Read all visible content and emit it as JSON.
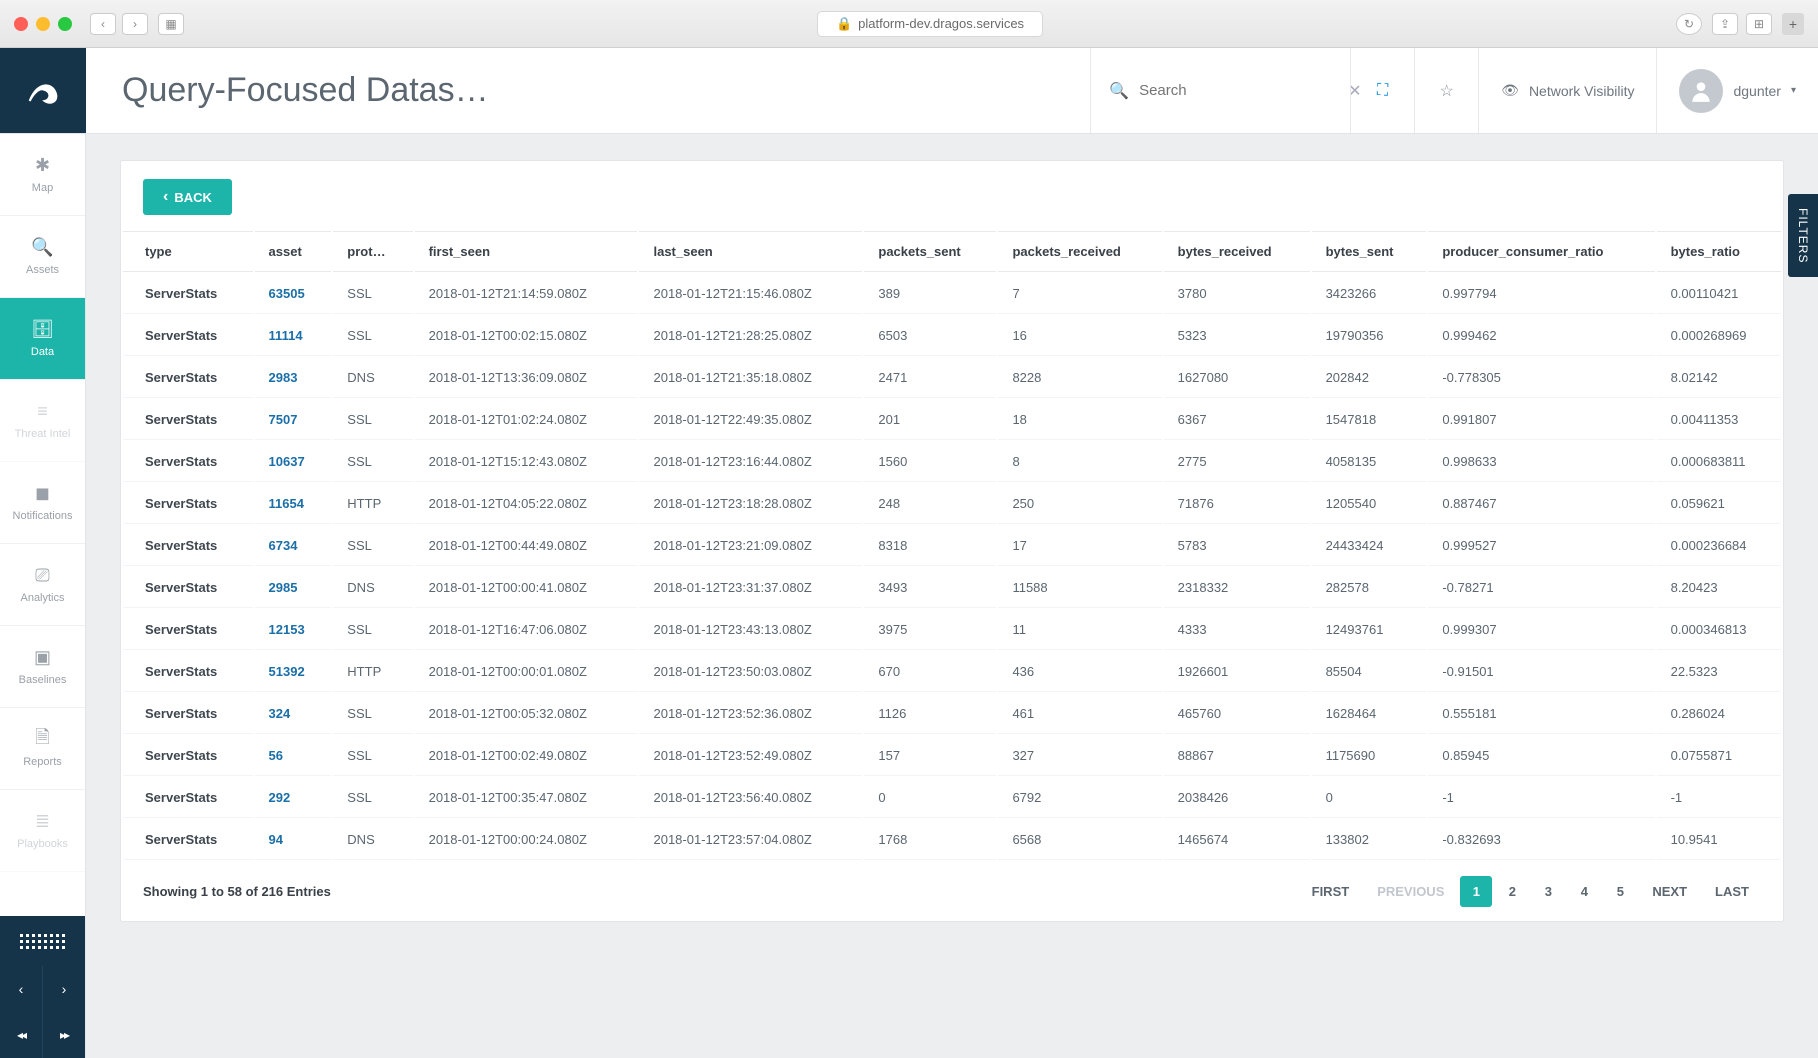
{
  "browser": {
    "url": "platform-dev.dragos.services"
  },
  "header": {
    "title": "Query-Focused Datas…",
    "search_placeholder": "Search",
    "visibility_label": "Network Visibility",
    "username": "dgunter"
  },
  "sidebar": {
    "items": [
      {
        "label": "Map",
        "active": false,
        "disabled": false,
        "icon": "map"
      },
      {
        "label": "Assets",
        "active": false,
        "disabled": false,
        "icon": "search"
      },
      {
        "label": "Data",
        "active": true,
        "disabled": false,
        "icon": "database"
      },
      {
        "label": "Threat Intel",
        "active": false,
        "disabled": true,
        "icon": "bars"
      },
      {
        "label": "Notifications",
        "active": false,
        "disabled": false,
        "icon": "bell"
      },
      {
        "label": "Analytics",
        "active": false,
        "disabled": false,
        "icon": "sliders"
      },
      {
        "label": "Baselines",
        "active": false,
        "disabled": false,
        "icon": "layers"
      },
      {
        "label": "Reports",
        "active": false,
        "disabled": false,
        "icon": "file"
      },
      {
        "label": "Playbooks",
        "active": false,
        "disabled": true,
        "icon": "stack"
      }
    ]
  },
  "back_label": "BACK",
  "filters_label": "FILTERS",
  "table": {
    "headers": [
      "type",
      "asset",
      "prot…",
      "first_seen",
      "last_seen",
      "packets_sent",
      "packets_received",
      "bytes_received",
      "bytes_sent",
      "producer_consumer_ratio",
      "bytes_ratio"
    ],
    "rows": [
      {
        "type": "ServerStats",
        "asset": "63505",
        "proto": "SSL",
        "first_seen": "2018-01-12T21:14:59.080Z",
        "last_seen": "2018-01-12T21:15:46.080Z",
        "pkts_sent": "389",
        "pkts_recv": "7",
        "bytes_recv": "3780",
        "bytes_sent": "3423266",
        "pcr": "0.997794",
        "bytes_ratio": "0.00110421"
      },
      {
        "type": "ServerStats",
        "asset": "11114",
        "proto": "SSL",
        "first_seen": "2018-01-12T00:02:15.080Z",
        "last_seen": "2018-01-12T21:28:25.080Z",
        "pkts_sent": "6503",
        "pkts_recv": "16",
        "bytes_recv": "5323",
        "bytes_sent": "19790356",
        "pcr": "0.999462",
        "bytes_ratio": "0.000268969"
      },
      {
        "type": "ServerStats",
        "asset": "2983",
        "proto": "DNS",
        "first_seen": "2018-01-12T13:36:09.080Z",
        "last_seen": "2018-01-12T21:35:18.080Z",
        "pkts_sent": "2471",
        "pkts_recv": "8228",
        "bytes_recv": "1627080",
        "bytes_sent": "202842",
        "pcr": "-0.778305",
        "bytes_ratio": "8.02142"
      },
      {
        "type": "ServerStats",
        "asset": "7507",
        "proto": "SSL",
        "first_seen": "2018-01-12T01:02:24.080Z",
        "last_seen": "2018-01-12T22:49:35.080Z",
        "pkts_sent": "201",
        "pkts_recv": "18",
        "bytes_recv": "6367",
        "bytes_sent": "1547818",
        "pcr": "0.991807",
        "bytes_ratio": "0.00411353"
      },
      {
        "type": "ServerStats",
        "asset": "10637",
        "proto": "SSL",
        "first_seen": "2018-01-12T15:12:43.080Z",
        "last_seen": "2018-01-12T23:16:44.080Z",
        "pkts_sent": "1560",
        "pkts_recv": "8",
        "bytes_recv": "2775",
        "bytes_sent": "4058135",
        "pcr": "0.998633",
        "bytes_ratio": "0.000683811"
      },
      {
        "type": "ServerStats",
        "asset": "11654",
        "proto": "HTTP",
        "first_seen": "2018-01-12T04:05:22.080Z",
        "last_seen": "2018-01-12T23:18:28.080Z",
        "pkts_sent": "248",
        "pkts_recv": "250",
        "bytes_recv": "71876",
        "bytes_sent": "1205540",
        "pcr": "0.887467",
        "bytes_ratio": "0.059621"
      },
      {
        "type": "ServerStats",
        "asset": "6734",
        "proto": "SSL",
        "first_seen": "2018-01-12T00:44:49.080Z",
        "last_seen": "2018-01-12T23:21:09.080Z",
        "pkts_sent": "8318",
        "pkts_recv": "17",
        "bytes_recv": "5783",
        "bytes_sent": "24433424",
        "pcr": "0.999527",
        "bytes_ratio": "0.000236684"
      },
      {
        "type": "ServerStats",
        "asset": "2985",
        "proto": "DNS",
        "first_seen": "2018-01-12T00:00:41.080Z",
        "last_seen": "2018-01-12T23:31:37.080Z",
        "pkts_sent": "3493",
        "pkts_recv": "11588",
        "bytes_recv": "2318332",
        "bytes_sent": "282578",
        "pcr": "-0.78271",
        "bytes_ratio": "8.20423"
      },
      {
        "type": "ServerStats",
        "asset": "12153",
        "proto": "SSL",
        "first_seen": "2018-01-12T16:47:06.080Z",
        "last_seen": "2018-01-12T23:43:13.080Z",
        "pkts_sent": "3975",
        "pkts_recv": "11",
        "bytes_recv": "4333",
        "bytes_sent": "12493761",
        "pcr": "0.999307",
        "bytes_ratio": "0.000346813"
      },
      {
        "type": "ServerStats",
        "asset": "51392",
        "proto": "HTTP",
        "first_seen": "2018-01-12T00:00:01.080Z",
        "last_seen": "2018-01-12T23:50:03.080Z",
        "pkts_sent": "670",
        "pkts_recv": "436",
        "bytes_recv": "1926601",
        "bytes_sent": "85504",
        "pcr": "-0.91501",
        "bytes_ratio": "22.5323"
      },
      {
        "type": "ServerStats",
        "asset": "324",
        "proto": "SSL",
        "first_seen": "2018-01-12T00:05:32.080Z",
        "last_seen": "2018-01-12T23:52:36.080Z",
        "pkts_sent": "1126",
        "pkts_recv": "461",
        "bytes_recv": "465760",
        "bytes_sent": "1628464",
        "pcr": "0.555181",
        "bytes_ratio": "0.286024"
      },
      {
        "type": "ServerStats",
        "asset": "56",
        "proto": "SSL",
        "first_seen": "2018-01-12T00:02:49.080Z",
        "last_seen": "2018-01-12T23:52:49.080Z",
        "pkts_sent": "157",
        "pkts_recv": "327",
        "bytes_recv": "88867",
        "bytes_sent": "1175690",
        "pcr": "0.85945",
        "bytes_ratio": "0.0755871"
      },
      {
        "type": "ServerStats",
        "asset": "292",
        "proto": "SSL",
        "first_seen": "2018-01-12T00:35:47.080Z",
        "last_seen": "2018-01-12T23:56:40.080Z",
        "pkts_sent": "0",
        "pkts_recv": "6792",
        "bytes_recv": "2038426",
        "bytes_sent": "0",
        "pcr": "-1",
        "bytes_ratio": "-1"
      },
      {
        "type": "ServerStats",
        "asset": "94",
        "proto": "DNS",
        "first_seen": "2018-01-12T00:00:24.080Z",
        "last_seen": "2018-01-12T23:57:04.080Z",
        "pkts_sent": "1768",
        "pkts_recv": "6568",
        "bytes_recv": "1465674",
        "bytes_sent": "133802",
        "pcr": "-0.832693",
        "bytes_ratio": "10.9541"
      }
    ],
    "showing_text": "Showing 1 to 58 of 216 Entries"
  },
  "pagination": {
    "first": "FIRST",
    "previous": "PREVIOUS",
    "next": "NEXT",
    "last": "LAST",
    "pages": [
      "1",
      "2",
      "3",
      "4",
      "5"
    ],
    "active": 1
  }
}
